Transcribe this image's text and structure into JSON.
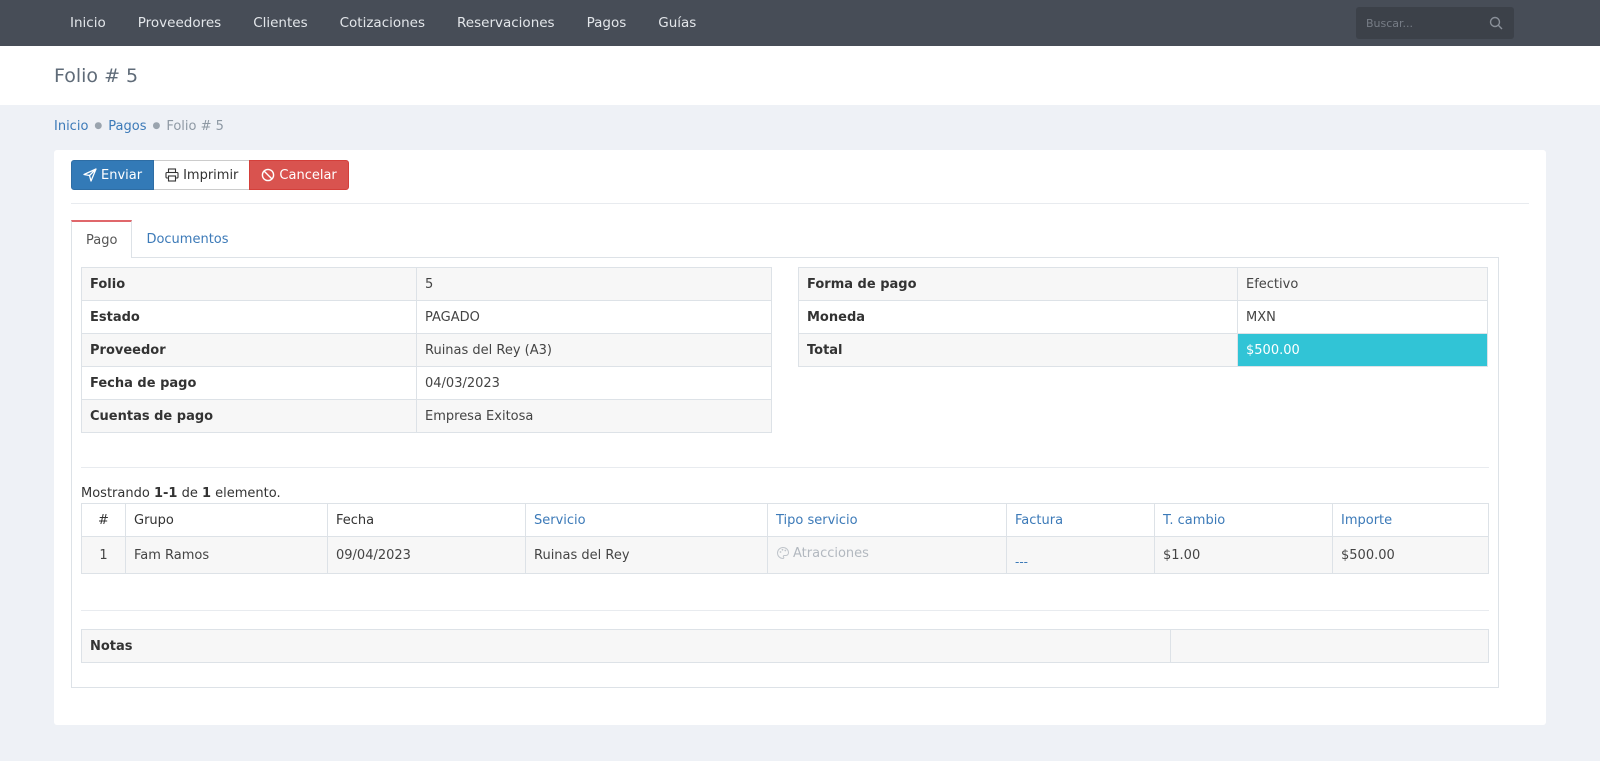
{
  "nav": {
    "items": [
      {
        "label": "Inicio"
      },
      {
        "label": "Proveedores"
      },
      {
        "label": "Clientes"
      },
      {
        "label": "Cotizaciones"
      },
      {
        "label": "Reservaciones"
      },
      {
        "label": "Pagos"
      },
      {
        "label": "Guías"
      }
    ],
    "search_placeholder": "Buscar...",
    "search_icon": "search-icon"
  },
  "page": {
    "title": "Folio # 5"
  },
  "breadcrumb": {
    "home": "Inicio",
    "section": "Pagos",
    "current": "Folio # 5"
  },
  "toolbar": {
    "send_label": "Enviar",
    "print_label": "Imprimir",
    "cancel_label": "Cancelar"
  },
  "tabs": {
    "pago": "Pago",
    "documentos": "Documentos"
  },
  "details_left": [
    {
      "label": "Folio",
      "value": "5"
    },
    {
      "label": "Estado",
      "value": "PAGADO"
    },
    {
      "label": "Proveedor",
      "value": "Ruinas del Rey (A3)"
    },
    {
      "label": "Fecha de pago",
      "value": "04/03/2023"
    },
    {
      "label": "Cuentas de pago",
      "value": "Empresa Exitosa"
    }
  ],
  "details_right": [
    {
      "label": "Forma de pago",
      "value": "Efectivo"
    },
    {
      "label": "Moneda",
      "value": "MXN"
    },
    {
      "label": "Total",
      "value": "$500.00"
    }
  ],
  "summary": {
    "prefix": "Mostrando ",
    "range": "1-1",
    "mid": " de ",
    "count": "1",
    "suffix": " elemento."
  },
  "items_table": {
    "headers": [
      "#",
      "Grupo",
      "Fecha",
      "Servicio",
      "Tipo servicio",
      "Factura",
      "T. cambio",
      "Importe"
    ],
    "rows": [
      {
        "num": "1",
        "grupo": "Fam Ramos",
        "fecha": "09/04/2023",
        "servicio": "Ruinas del Rey",
        "tipo": "Atracciones",
        "factura": "---",
        "tcambio": "$1.00",
        "importe": "$500.00"
      }
    ]
  },
  "notes": {
    "label": "Notas",
    "value": ""
  },
  "colors": {
    "navbar": "#474d57",
    "primary": "#337ab7",
    "danger": "#d9534f",
    "total_highlight": "#31c4d6",
    "tab_active_accent": "#e0676b"
  }
}
